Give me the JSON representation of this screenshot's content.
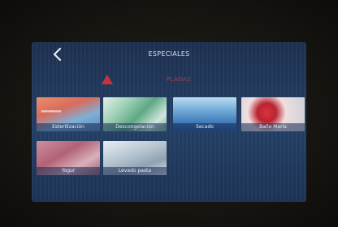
{
  "header": {
    "title": "ESPECIALES",
    "back_icon": "chevron-left-icon"
  },
  "category": {
    "label": "PLAGAS",
    "icon": "warning-triangle-icon",
    "color": "#c8323a"
  },
  "programs": [
    {
      "label": "Esterilización"
    },
    {
      "label": "Descongelación"
    },
    {
      "label": "Secado"
    },
    {
      "label": "Baño María"
    },
    {
      "label": "Yogur"
    },
    {
      "label": "Levado pasta"
    }
  ],
  "colors": {
    "screen": "#223a5e",
    "bezel": "#1b1914",
    "caption_text": "#e8eef8"
  }
}
